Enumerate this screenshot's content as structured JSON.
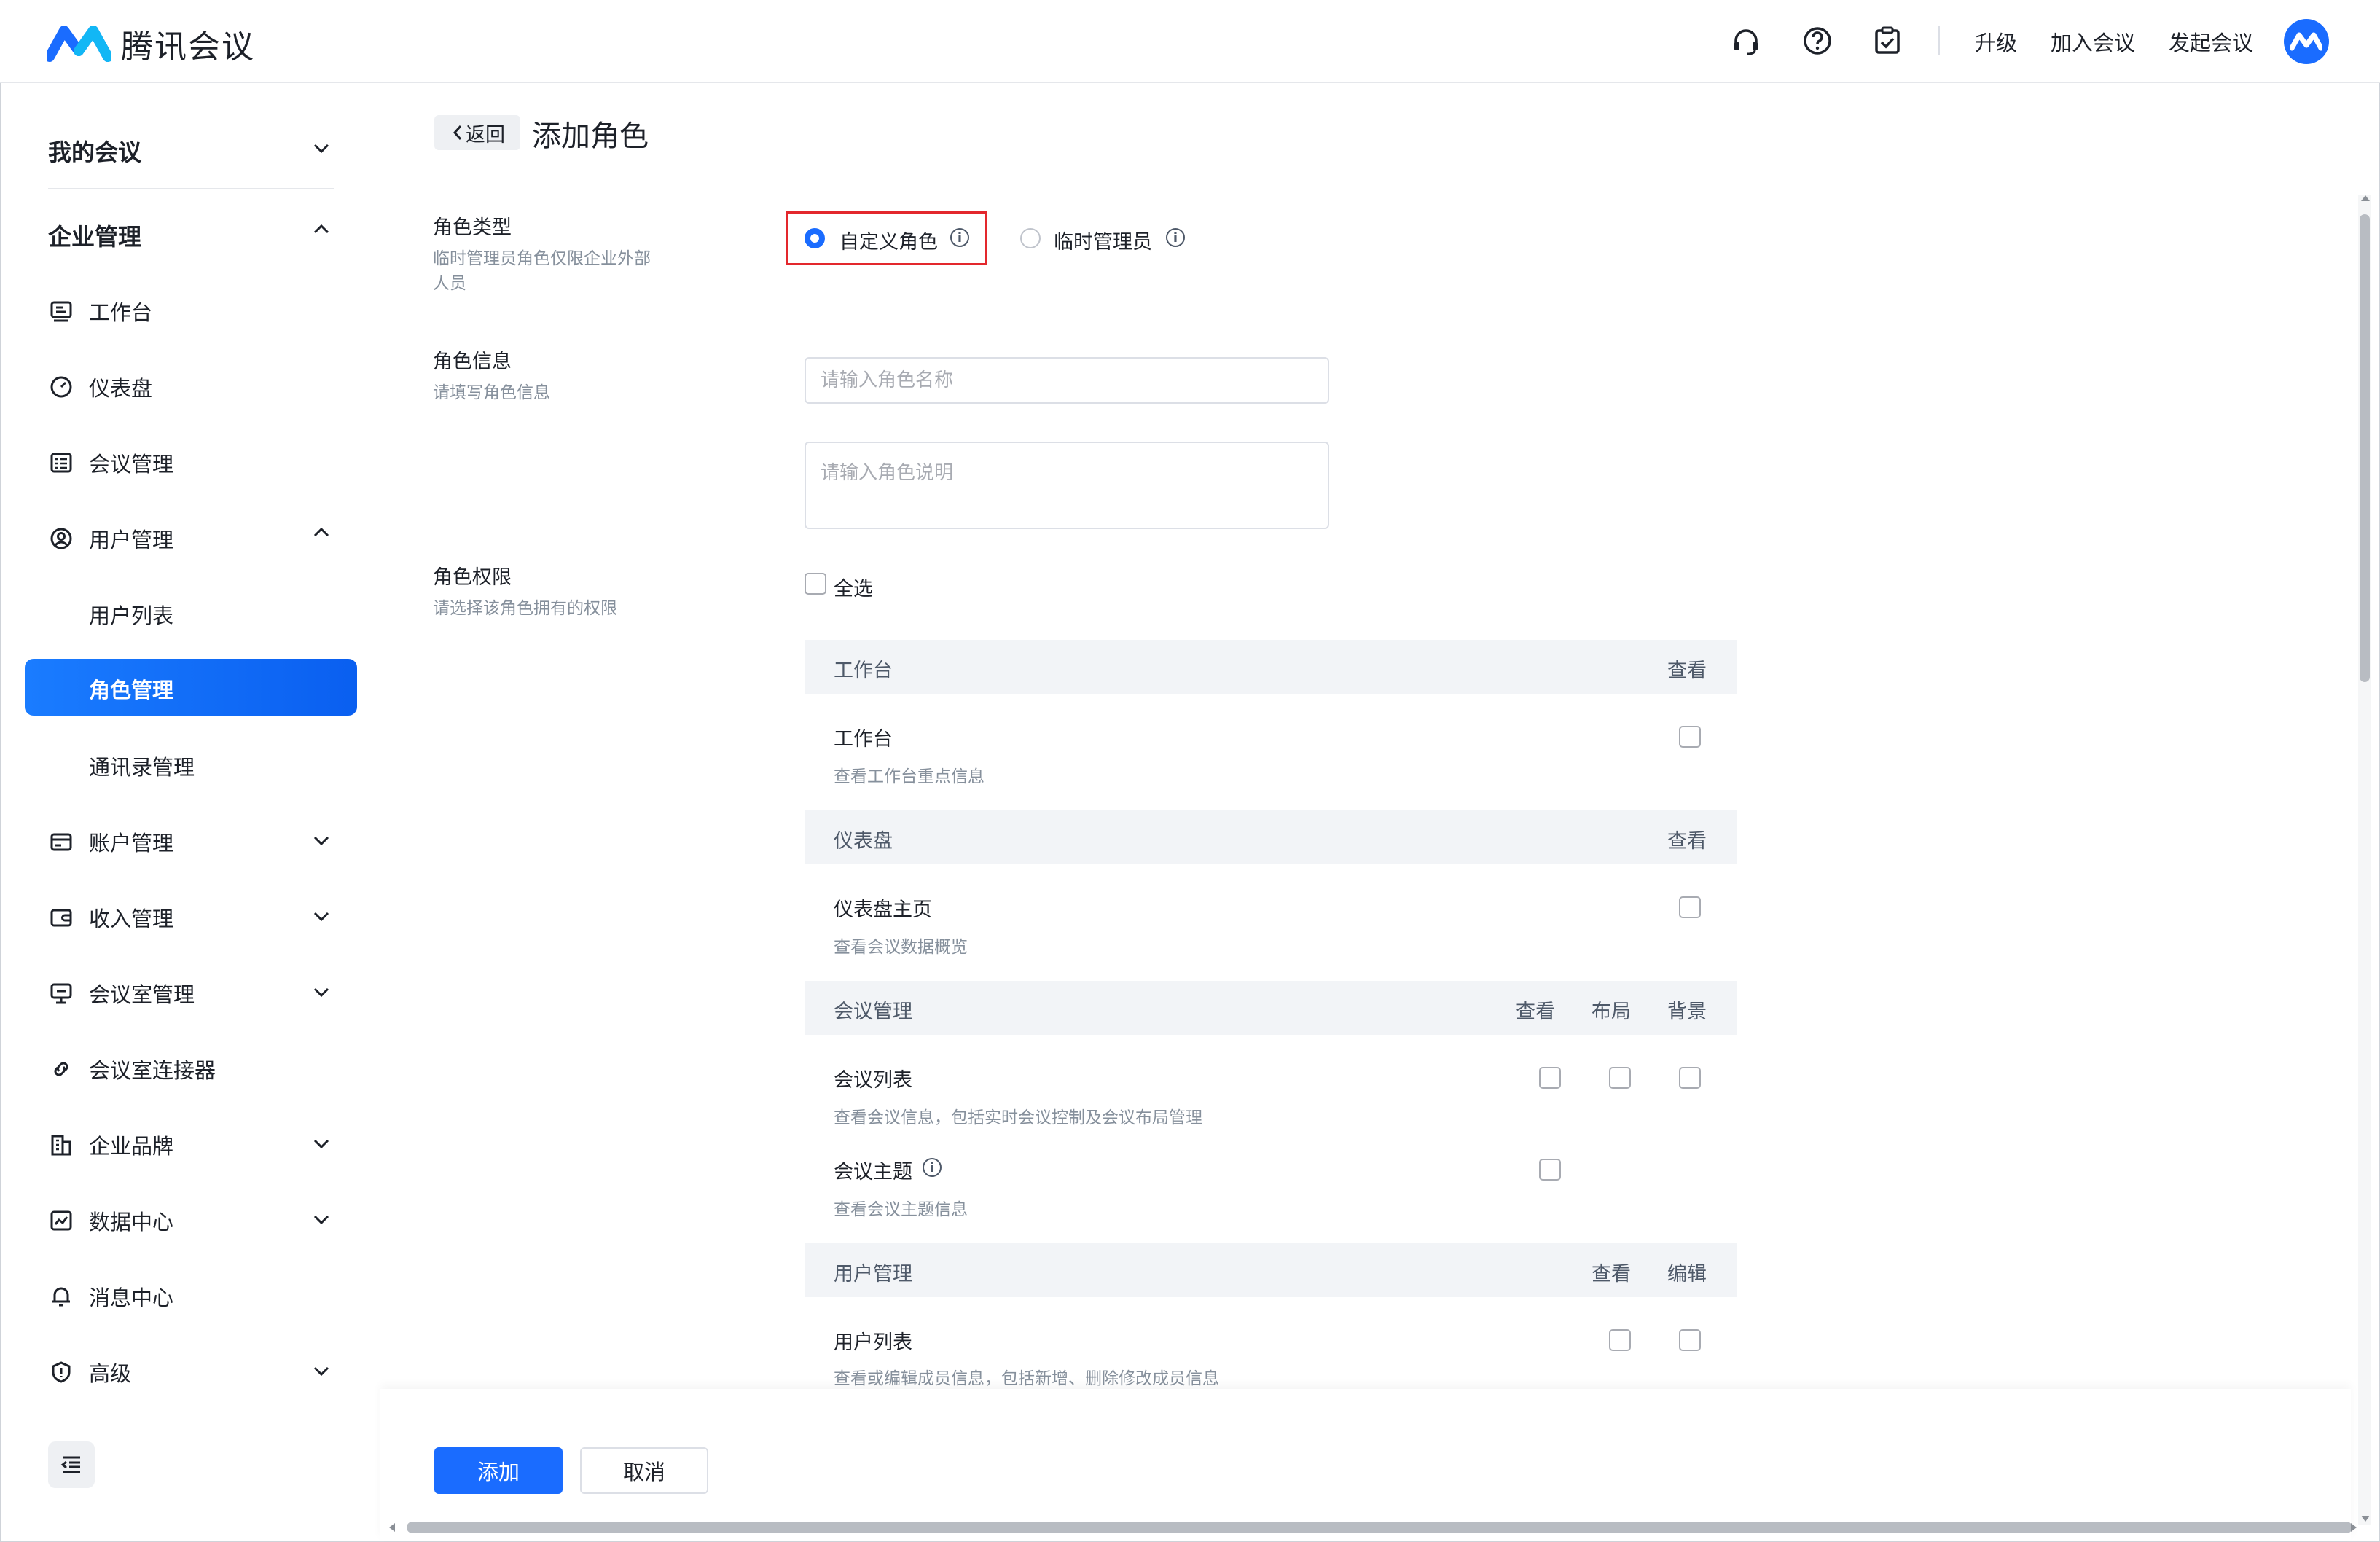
{
  "header": {
    "app_name": "腾讯会议",
    "links": [
      "升级",
      "加入会议",
      "发起会议"
    ],
    "icons": [
      "headset-icon",
      "help-icon",
      "clipboard-check-icon"
    ],
    "brand_color": "#1a6cff"
  },
  "sidebar": {
    "my_meetings": "我的会议",
    "enterprise": "企业管理",
    "items": {
      "workbench": "工作台",
      "dashboard": "仪表盘",
      "meeting_mgmt": "会议管理",
      "user_mgmt": "用户管理",
      "user_list": "用户列表",
      "role_mgmt": "角色管理",
      "contacts_mgmt": "通讯录管理",
      "account_mgmt": "账户管理",
      "revenue_mgmt": "收入管理",
      "room_mgmt": "会议室管理",
      "room_connector": "会议室连接器",
      "brand": "企业品牌",
      "data_center": "数据中心",
      "message_center": "消息中心",
      "advanced": "高级"
    }
  },
  "main": {
    "back": "返回",
    "title": "添加角色",
    "role_type": {
      "label": "角色类型",
      "desc": "临时管理员角色仅限企业外部人员",
      "options": [
        "自定义角色",
        "临时管理员"
      ],
      "selected": "自定义角色"
    },
    "role_info": {
      "label": "角色信息",
      "desc": "请填写角色信息",
      "name_placeholder": "请输入角色名称",
      "desc_placeholder": "请输入角色说明"
    },
    "permissions": {
      "label": "角色权限",
      "desc": "请选择该角色拥有的权限",
      "select_all": "全选",
      "sections": [
        {
          "title": "工作台",
          "cols": [
            "查看"
          ],
          "rows": [
            {
              "name": "工作台",
              "desc": "查看工作台重点信息"
            }
          ]
        },
        {
          "title": "仪表盘",
          "cols": [
            "查看"
          ],
          "rows": [
            {
              "name": "仪表盘主页",
              "desc": "查看会议数据概览"
            }
          ]
        },
        {
          "title": "会议管理",
          "cols": [
            "查看",
            "布局",
            "背景"
          ],
          "rows": [
            {
              "name": "会议列表",
              "desc": "查看会议信息，包括实时会议控制及会议布局管理"
            },
            {
              "name": "会议主题",
              "desc": "查看会议主题信息"
            }
          ]
        },
        {
          "title": "用户管理",
          "cols": [
            "查看",
            "编辑"
          ],
          "rows": [
            {
              "name": "用户列表",
              "desc": "查看或编辑成员信息，包括新增、删除修改成员信息"
            }
          ]
        }
      ]
    }
  },
  "footer": {
    "add": "添加",
    "cancel": "取消"
  }
}
